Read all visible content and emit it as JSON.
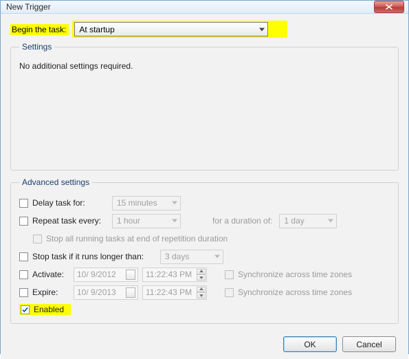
{
  "window": {
    "title": "New Trigger"
  },
  "begin": {
    "label": "Begin the task:",
    "selected": "At startup"
  },
  "settings": {
    "legend": "Settings",
    "body": "No additional settings required."
  },
  "advanced": {
    "legend": "Advanced settings",
    "delay": {
      "label": "Delay task for:",
      "value": "15 minutes"
    },
    "repeat": {
      "label": "Repeat task every:",
      "value": "1 hour",
      "duration_label": "for a duration of:",
      "duration_value": "1 day",
      "stop_label": "Stop all running tasks at end of repetition duration"
    },
    "stop_longer": {
      "label": "Stop task if it runs longer than:",
      "value": "3 days"
    },
    "activate": {
      "label": "Activate:",
      "date": "10/ 9/2012",
      "time": "11:22:43 PM",
      "sync_label": "Synchronize across time zones"
    },
    "expire": {
      "label": "Expire:",
      "date": "10/ 9/2013",
      "time": "11:22:43 PM",
      "sync_label": "Synchronize across time zones"
    },
    "enabled": {
      "label": "Enabled"
    }
  },
  "buttons": {
    "ok": "OK",
    "cancel": "Cancel"
  }
}
